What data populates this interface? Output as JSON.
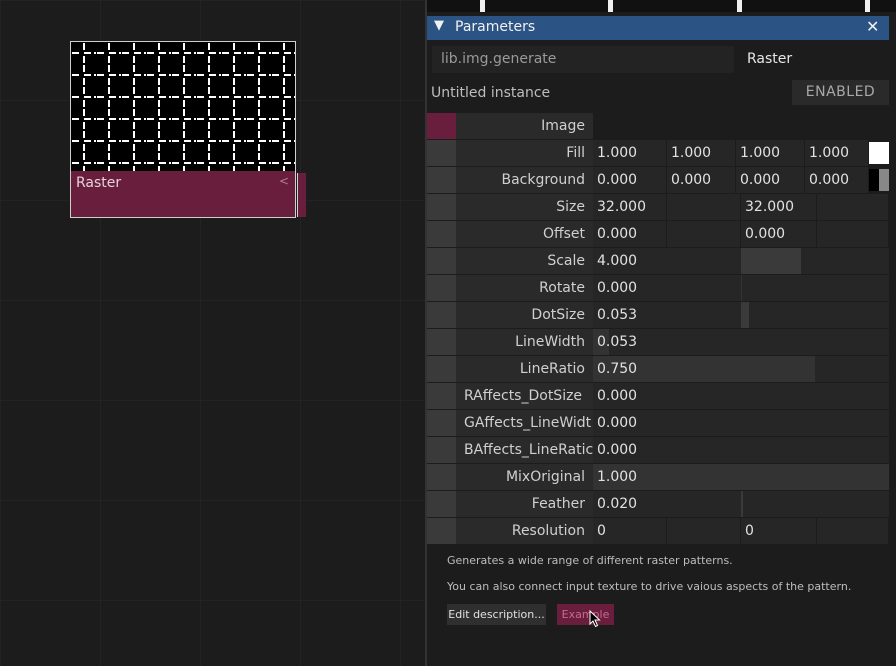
{
  "node": {
    "title": "Raster",
    "collapse_arrow": "<"
  },
  "panel": {
    "title": "Parameters",
    "collapse_icon": "▼",
    "close_icon": "✕",
    "op_path": "lib.img.generate",
    "op_name": "Raster",
    "instance_name": "Untitled instance",
    "enabled_label": "ENABLED"
  },
  "params": {
    "image": {
      "label": "Image"
    },
    "fill": {
      "label": "Fill",
      "values": [
        "1.000",
        "1.000",
        "1.000",
        "1.000"
      ],
      "swatch": "#ffffff"
    },
    "background": {
      "label": "Background",
      "values": [
        "0.000",
        "0.000",
        "0.000",
        "0.000"
      ],
      "swatch": "#000000"
    },
    "size": {
      "label": "Size",
      "values": [
        "32.000",
        "32.000"
      ]
    },
    "offset": {
      "label": "Offset",
      "values": [
        "0.000",
        "0.000"
      ]
    },
    "scale": {
      "label": "Scale",
      "value": "4.000"
    },
    "rotate": {
      "label": "Rotate",
      "value": "0.000"
    },
    "dotsize": {
      "label": "DotSize",
      "value": "0.053"
    },
    "linewidth": {
      "label": "LineWidth",
      "value": "0.053"
    },
    "lineratio": {
      "label": "LineRatio",
      "value": "0.750"
    },
    "raffects": {
      "label": "RAffects_DotSize",
      "value": "0.000"
    },
    "gaffects": {
      "label": "GAffects_LineWidt",
      "value": "0.000"
    },
    "baffects": {
      "label": "BAffects_LineRatic",
      "value": "0.000"
    },
    "mixoriginal": {
      "label": "MixOriginal",
      "value": "1.000"
    },
    "feather": {
      "label": "Feather",
      "value": "0.020"
    },
    "resolution": {
      "label": "Resolution",
      "values": [
        "0",
        "0"
      ]
    }
  },
  "description": {
    "line1": "Generates a wide range of different raster patterns.",
    "line2": "You can also connect input texture to drive vaious aspects of the pattern.",
    "edit_button": "Edit description...",
    "example_button": "Example"
  },
  "colors": {
    "accent": "#6a1e3d",
    "header": "#2b5383"
  }
}
